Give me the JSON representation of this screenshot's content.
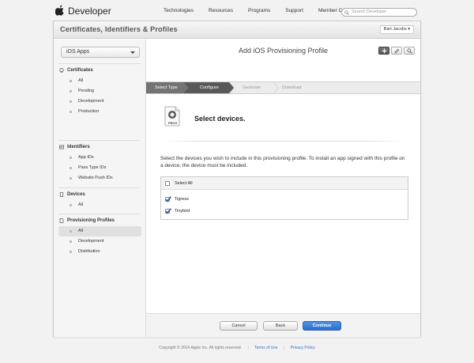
{
  "topnav": {
    "brand": "Developer",
    "links": [
      "Technologies",
      "Resources",
      "Programs",
      "Support",
      "Member Center"
    ],
    "search_placeholder": "Search Developer"
  },
  "header": {
    "title": "Certificates, Identifiers & Profiles",
    "user": "Bart Jacobs"
  },
  "sidebar": {
    "platform": "iOS Apps",
    "sections": [
      {
        "title": "Certificates",
        "icon": "certificate-icon",
        "items": [
          "All",
          "Pending",
          "Development",
          "Production"
        ]
      },
      {
        "title": "Identifiers",
        "icon": "id-card-icon",
        "items": [
          "App IDs",
          "Pass Type IDs",
          "Website Push IDs"
        ]
      },
      {
        "title": "Devices",
        "icon": "device-icon",
        "items": [
          "All"
        ]
      },
      {
        "title": "Provisioning Profiles",
        "icon": "document-icon",
        "items": [
          "All",
          "Development",
          "Distribution"
        ],
        "active_item": "All"
      }
    ]
  },
  "main": {
    "title": "Add iOS Provisioning Profile",
    "steps": [
      {
        "label": "Select Type",
        "state": "done"
      },
      {
        "label": "Configure",
        "state": "current"
      },
      {
        "label": "Generate",
        "state": "todo"
      },
      {
        "label": "Download",
        "state": "todo"
      }
    ],
    "prov_label": "PROV",
    "heading": "Select devices.",
    "description": "Select the devices you wish to include in this provisioning profile. To install an app signed with this profile on a device, the device must be included.",
    "select_all": {
      "label": "Select All",
      "checked": false
    },
    "devices": [
      {
        "name": "Tigress",
        "checked": true
      },
      {
        "name": "Tinybird",
        "checked": true
      }
    ]
  },
  "buttons": {
    "cancel": "Cancel",
    "back": "Back",
    "continue": "Continue"
  },
  "footer": {
    "copyright": "Copyright © 2014 Apple Inc. All rights reserved.",
    "terms": "Terms of Use",
    "privacy": "Privacy Policy"
  },
  "colors": {
    "primary": "#2d6fcc",
    "step_active": "#555555",
    "link": "#3b6ec1"
  }
}
